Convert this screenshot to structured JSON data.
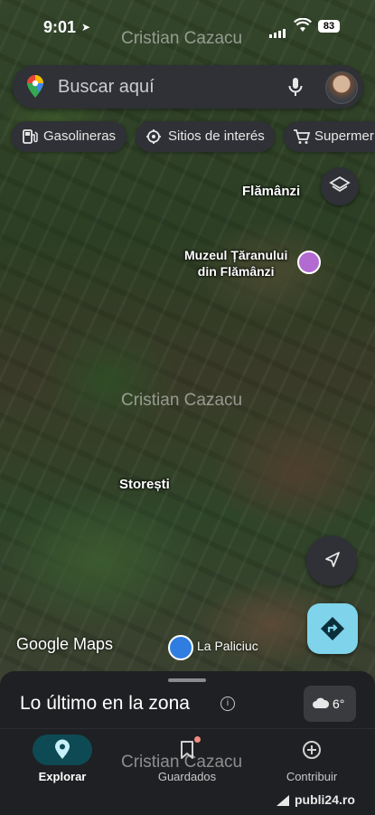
{
  "status_bar": {
    "time": "9:01",
    "battery": "83"
  },
  "watermarks": [
    "Cristian Cazacu",
    "Cristian Cazacu",
    "Cristian Cazacu"
  ],
  "search": {
    "placeholder": "Buscar aquí"
  },
  "chips": [
    {
      "label": "Gasolineras",
      "icon": "gas-station-icon"
    },
    {
      "label": "Sitios de interés",
      "icon": "landmark-icon"
    },
    {
      "label": "Supermer",
      "icon": "shopping-cart-icon"
    }
  ],
  "map": {
    "places": [
      "Flămânzi",
      "Storești"
    ],
    "poi_museum": "Muzeul Țăranului\ndin Flămânzi",
    "poi_store": "La Paliciuc",
    "attribution": "Google Maps"
  },
  "sheet": {
    "title": "Lo último en la zona",
    "weather": "6°"
  },
  "tabs": [
    {
      "label": "Explorar",
      "active": true
    },
    {
      "label": "Guardados",
      "active": false
    },
    {
      "label": "Contribuir",
      "active": false
    }
  ],
  "brand": "publi24.ro",
  "colors": {
    "accent": "#0e4a54",
    "directions": "#7fd3ea",
    "poi_museum": "#b36ad1",
    "poi_store": "#2f7de1"
  }
}
